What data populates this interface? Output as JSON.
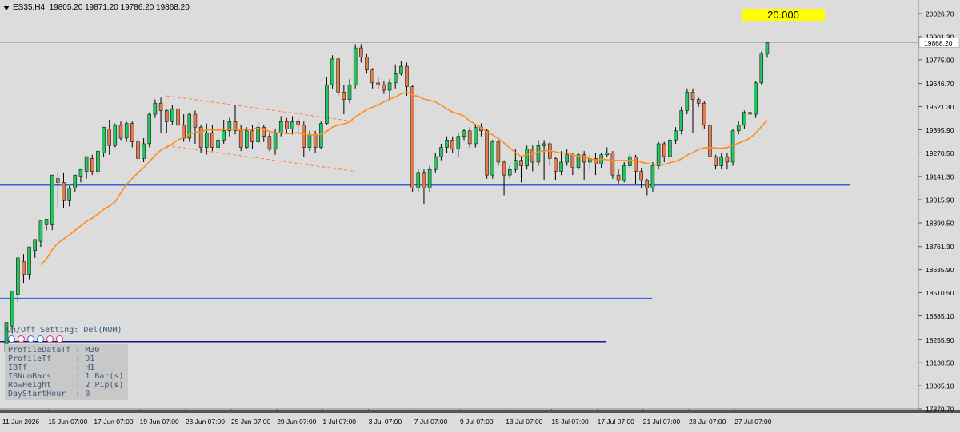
{
  "header": {
    "symbol_text": "ES35,H4  19805.20 19871.20 19786.20 19868.20"
  },
  "price_box": {
    "label": "20.000"
  },
  "price_axis": {
    "labels": [
      "20026.70",
      "19901.30",
      "19775.90",
      "19646.70",
      "19521.30",
      "19395.90",
      "19270.50",
      "19141.30",
      "19015.90",
      "18890.50",
      "18761.30",
      "18635.90",
      "18510.50",
      "18385.10",
      "18255.90",
      "18130.50",
      "18005.10",
      "17879.70"
    ],
    "current_price": "19868.20"
  },
  "time_axis": {
    "labels": [
      "11 Jun 2026",
      "15 Jun 07:00",
      "17 Jun 07:00",
      "19 Jun 07:00",
      "23 Jun 07:00",
      "25 Jun 07:00",
      "29 Jun 07:00",
      "1 Jul 07:00",
      "3 Jul 07:00",
      "7 Jul 07:00",
      "9 Jul 07:00",
      "13 Jul 07:00",
      "15 Jul 07:00",
      "17 Jul 07:00",
      "21 Jul 07:00",
      "23 Jul 07:00",
      "27 Jul 07:00"
    ]
  },
  "settings": {
    "title": "On/Off Setting: Del(NUM)",
    "rows": [
      "ProfileDataTf : M30",
      "ProfileTf     : D1",
      "IBTf          : H1",
      "IBNumBars     : 1 Bar(s)",
      "RowHeight     : 2 Pip(s)",
      "DayStartHour  : 0"
    ],
    "dot_colors": [
      "#3a6fd8",
      "#e0306a",
      "#3a6fd8",
      "#3a6fd8",
      "#e0306a",
      "#e0306a"
    ]
  },
  "colors": {
    "bull": "#22c55e",
    "bear": "#e07b4a",
    "ma": "#ff8c1a",
    "hline_blue": "#3a63d8",
    "hline_navy": "#1a1a7a",
    "channel": "#ff8040"
  },
  "chart_data": {
    "type": "candlestick",
    "price_range": [
      17879.7,
      20026.7
    ],
    "horizontal_lines": [
      19095,
      18480,
      18245
    ],
    "current_price": 19868.2,
    "candles": [
      [
        18190,
        18350,
        18080,
        18330
      ],
      [
        18330,
        18520,
        18290,
        18500
      ],
      [
        18500,
        18700,
        18460,
        18680
      ],
      [
        18680,
        18610,
        18560,
        18720
      ],
      [
        18610,
        18760,
        18580,
        18740
      ],
      [
        18740,
        18800,
        18700,
        18790
      ],
      [
        18790,
        18900,
        18760,
        18880
      ],
      [
        18880,
        18910,
        18850,
        18880
      ],
      [
        18880,
        19150,
        18850,
        19130
      ],
      [
        19130,
        19110,
        18970,
        19160
      ],
      [
        19110,
        19010,
        18970,
        19160
      ],
      [
        19010,
        19080,
        18980,
        19090
      ],
      [
        19080,
        19150,
        19060,
        19140
      ],
      [
        19140,
        19180,
        19110,
        19170
      ],
      [
        19170,
        19250,
        19130,
        19240
      ],
      [
        19240,
        19170,
        19150,
        19260
      ],
      [
        19170,
        19280,
        19150,
        19270
      ],
      [
        19270,
        19410,
        19250,
        19400
      ],
      [
        19400,
        19310,
        19260,
        19450
      ],
      [
        19310,
        19420,
        19300,
        19430
      ],
      [
        19420,
        19350,
        19340,
        19440
      ],
      [
        19350,
        19430,
        19330,
        19440
      ],
      [
        19430,
        19330,
        19300,
        19440
      ],
      [
        19330,
        19240,
        19220,
        19350
      ],
      [
        19240,
        19320,
        19220,
        19350
      ],
      [
        19320,
        19480,
        19300,
        19490
      ],
      [
        19480,
        19540,
        19460,
        19560
      ],
      [
        19540,
        19500,
        19380,
        19570
      ],
      [
        19500,
        19440,
        19380,
        19510
      ],
      [
        19440,
        19510,
        19420,
        19530
      ],
      [
        19510,
        19420,
        19390,
        19530
      ],
      [
        19420,
        19350,
        19330,
        19480
      ],
      [
        19350,
        19480,
        19330,
        19490
      ],
      [
        19480,
        19410,
        19320,
        19500
      ],
      [
        19410,
        19300,
        19270,
        19420
      ],
      [
        19300,
        19380,
        19260,
        19430
      ],
      [
        19380,
        19300,
        19280,
        19420
      ],
      [
        19300,
        19340,
        19280,
        19380
      ],
      [
        19340,
        19390,
        19320,
        19450
      ],
      [
        19390,
        19440,
        19360,
        19460
      ],
      [
        19440,
        19390,
        19370,
        19530
      ],
      [
        19390,
        19300,
        19280,
        19420
      ],
      [
        19300,
        19390,
        19290,
        19410
      ],
      [
        19390,
        19330,
        19290,
        19420
      ],
      [
        19330,
        19410,
        19310,
        19440
      ],
      [
        19410,
        19360,
        19330,
        19420
      ],
      [
        19360,
        19290,
        19280,
        19380
      ],
      [
        19290,
        19380,
        19260,
        19400
      ],
      [
        19380,
        19440,
        19360,
        19470
      ],
      [
        19440,
        19400,
        19380,
        19460
      ],
      [
        19400,
        19440,
        19370,
        19470
      ],
      [
        19440,
        19420,
        19380,
        19460
      ],
      [
        19420,
        19300,
        19250,
        19440
      ],
      [
        19300,
        19370,
        19280,
        19390
      ],
      [
        19370,
        19300,
        19270,
        19390
      ],
      [
        19300,
        19430,
        19290,
        19440
      ],
      [
        19430,
        19640,
        19420,
        19680
      ],
      [
        19640,
        19780,
        19620,
        19800
      ],
      [
        19780,
        19600,
        19580,
        19790
      ],
      [
        19600,
        19560,
        19480,
        19640
      ],
      [
        19560,
        19640,
        19540,
        19670
      ],
      [
        19640,
        19840,
        19620,
        19860
      ],
      [
        19840,
        19790,
        19760,
        19860
      ],
      [
        19790,
        19720,
        19700,
        19810
      ],
      [
        19720,
        19650,
        19620,
        19730
      ],
      [
        19650,
        19640,
        19620,
        19680
      ],
      [
        19640,
        19610,
        19590,
        19660
      ],
      [
        19610,
        19650,
        19560,
        19670
      ],
      [
        19650,
        19700,
        19620,
        19750
      ],
      [
        19700,
        19740,
        19690,
        19770
      ],
      [
        19740,
        19630,
        19580,
        19760
      ],
      [
        19630,
        19080,
        19060,
        19640
      ],
      [
        19080,
        19160,
        19060,
        19180
      ],
      [
        19160,
        19080,
        18990,
        19180
      ],
      [
        19080,
        19180,
        19060,
        19200
      ],
      [
        19180,
        19250,
        19160,
        19270
      ],
      [
        19250,
        19300,
        19230,
        19320
      ],
      [
        19300,
        19340,
        19270,
        19360
      ],
      [
        19340,
        19290,
        19270,
        19360
      ],
      [
        19290,
        19360,
        19250,
        19380
      ],
      [
        19360,
        19390,
        19340,
        19400
      ],
      [
        19390,
        19320,
        19300,
        19410
      ],
      [
        19320,
        19410,
        19300,
        19420
      ],
      [
        19410,
        19390,
        19360,
        19430
      ],
      [
        19390,
        19150,
        19130,
        19400
      ],
      [
        19150,
        19330,
        19130,
        19340
      ],
      [
        19330,
        19220,
        19200,
        19340
      ],
      [
        19220,
        19150,
        19040,
        19230
      ],
      [
        19150,
        19180,
        19130,
        19200
      ],
      [
        19180,
        19230,
        19160,
        19290
      ],
      [
        19230,
        19200,
        19110,
        19250
      ],
      [
        19200,
        19290,
        19180,
        19310
      ],
      [
        19290,
        19220,
        19170,
        19310
      ],
      [
        19220,
        19310,
        19200,
        19340
      ],
      [
        19310,
        19320,
        19120,
        19340
      ],
      [
        19320,
        19240,
        19200,
        19330
      ],
      [
        19240,
        19170,
        19120,
        19250
      ],
      [
        19170,
        19220,
        19150,
        19280
      ],
      [
        19220,
        19260,
        19200,
        19290
      ],
      [
        19260,
        19190,
        19150,
        19270
      ],
      [
        19190,
        19260,
        19180,
        19270
      ],
      [
        19260,
        19220,
        19120,
        19280
      ],
      [
        19220,
        19240,
        19180,
        19260
      ],
      [
        19240,
        19210,
        19150,
        19270
      ],
      [
        19210,
        19260,
        19190,
        19270
      ],
      [
        19260,
        19270,
        19250,
        19300
      ],
      [
        19270,
        19150,
        19130,
        19280
      ],
      [
        19150,
        19120,
        19100,
        19180
      ],
      [
        19120,
        19200,
        19110,
        19220
      ],
      [
        19200,
        19250,
        19180,
        19270
      ],
      [
        19250,
        19170,
        19100,
        19260
      ],
      [
        19170,
        19120,
        19080,
        19190
      ],
      [
        19120,
        19080,
        19040,
        19130
      ],
      [
        19080,
        19200,
        19060,
        19220
      ],
      [
        19200,
        19320,
        19180,
        19330
      ],
      [
        19320,
        19250,
        19220,
        19330
      ],
      [
        19250,
        19340,
        19230,
        19350
      ],
      [
        19340,
        19390,
        19320,
        19410
      ],
      [
        19390,
        19500,
        19370,
        19520
      ],
      [
        19500,
        19600,
        19480,
        19620
      ],
      [
        19600,
        19560,
        19380,
        19620
      ],
      [
        19560,
        19540,
        19520,
        19570
      ],
      [
        19540,
        19420,
        19400,
        19550
      ],
      [
        19420,
        19250,
        19230,
        19430
      ],
      [
        19250,
        19200,
        19180,
        19260
      ],
      [
        19200,
        19250,
        19180,
        19270
      ],
      [
        19250,
        19220,
        19180,
        19270
      ],
      [
        19220,
        19390,
        19200,
        19400
      ],
      [
        19390,
        19420,
        19370,
        19440
      ],
      [
        19420,
        19490,
        19400,
        19500
      ],
      [
        19490,
        19480,
        19460,
        19510
      ],
      [
        19480,
        19650,
        19460,
        19660
      ],
      [
        19650,
        19810,
        19640,
        19820
      ],
      [
        19810,
        19868.2,
        19786.2,
        19871.2
      ]
    ]
  }
}
